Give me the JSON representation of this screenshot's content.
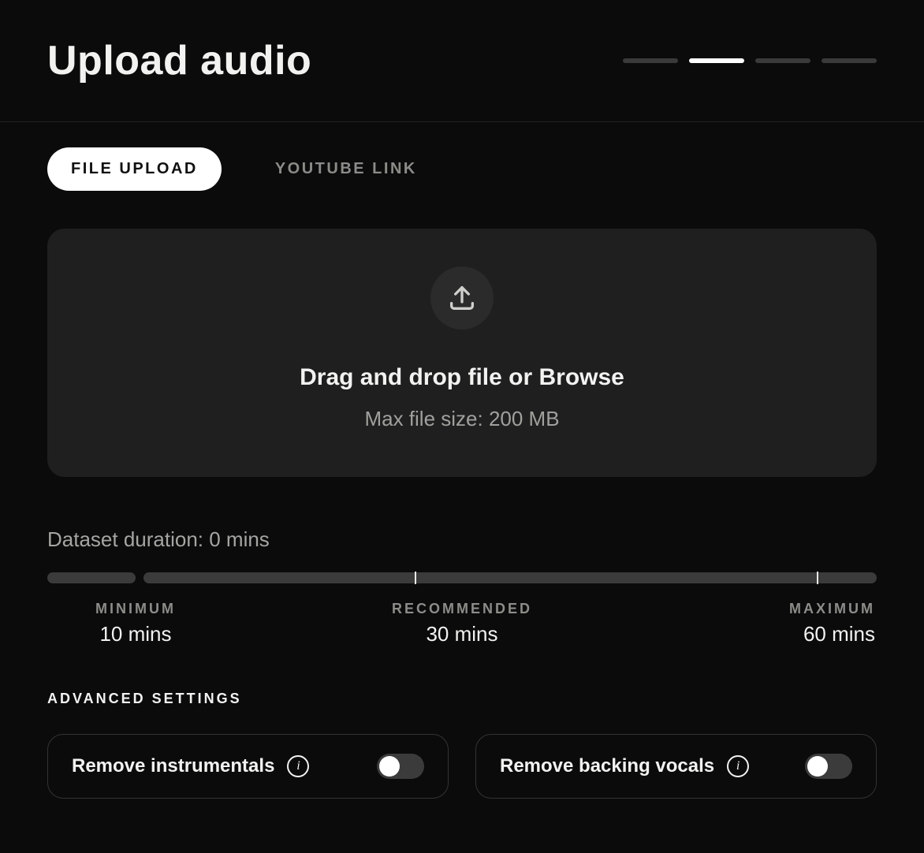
{
  "header": {
    "title": "Upload audio",
    "stepper": {
      "total": 4,
      "active_index": 1
    }
  },
  "tabs": [
    {
      "id": "file-upload",
      "label": "FILE UPLOAD",
      "active": true
    },
    {
      "id": "youtube-link",
      "label": "YOUTUBE LINK",
      "active": false
    }
  ],
  "dropzone": {
    "icon": "upload-icon",
    "text": "Drag and drop file or Browse",
    "subtext": "Max file size: 200 MB"
  },
  "duration": {
    "label": "Dataset duration: 0 mins",
    "marks": {
      "minimum": {
        "label": "MINIMUM",
        "value": "10 mins"
      },
      "recommended": {
        "label": "RECOMMENDED",
        "value": "30 mins"
      },
      "maximum": {
        "label": "MAXIMUM",
        "value": "60 mins"
      }
    }
  },
  "advanced": {
    "title": "ADVANCED SETTINGS",
    "options": [
      {
        "id": "remove-instrumentals",
        "label": "Remove instrumentals",
        "enabled": false
      },
      {
        "id": "remove-backing-vocals",
        "label": "Remove backing vocals",
        "enabled": false
      }
    ]
  }
}
